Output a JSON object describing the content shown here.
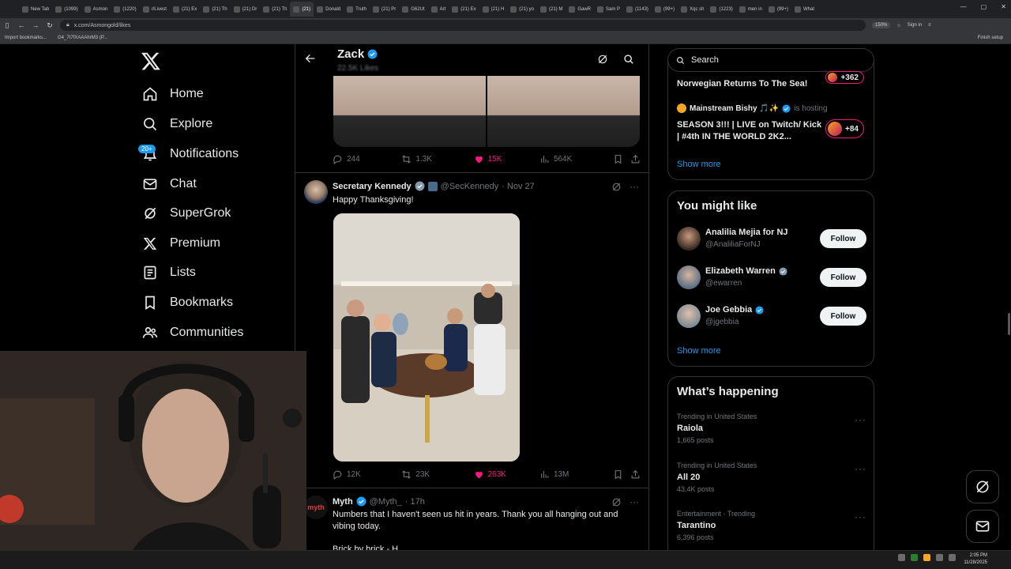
{
  "browser": {
    "tabs": [
      "New Tab",
      "(1099)",
      "Asmon",
      "(1220)",
      "r/Livest",
      "(21) Ex",
      "(21) Th",
      "(21) Dr",
      "(21) Th",
      "(21)",
      "Donald",
      "Truth",
      "(21) Pr",
      "G62Ut",
      "Art",
      "(21) Ex",
      "(21) H",
      "(21) yo",
      "(21) M",
      "GawR",
      "Sam P",
      "(1143)",
      "(99+)",
      "Xqc sh",
      "(1223)",
      "men in",
      "(99+)",
      "What"
    ],
    "active_tab_index": 9,
    "url": "x.com/Asmongold/likes",
    "zoom": "150%",
    "sign_in": "Sign in",
    "bookmarks": [
      "Import bookmarks...",
      "G4_7t7fXAAAhrM3 (P..."
    ],
    "finish_setup": "Finish setup",
    "window_controls": [
      "—",
      "▢",
      "✕"
    ]
  },
  "nav": {
    "items": [
      {
        "label": "Home",
        "icon": "home-icon"
      },
      {
        "label": "Explore",
        "icon": "search-icon"
      },
      {
        "label": "Notifications",
        "icon": "bell-icon",
        "badge": "20+"
      },
      {
        "label": "Chat",
        "icon": "mail-icon"
      },
      {
        "label": "SuperGrok",
        "icon": "grok-icon"
      },
      {
        "label": "Premium",
        "icon": "x-logo-icon"
      },
      {
        "label": "Lists",
        "icon": "list-icon"
      },
      {
        "label": "Bookmarks",
        "icon": "bookmark-icon"
      },
      {
        "label": "Communities",
        "icon": "communities-icon"
      }
    ]
  },
  "header": {
    "name": "Zack",
    "likes": "22.5K Likes"
  },
  "tweet1_actions": {
    "replies": "244",
    "reposts": "1.3K",
    "likes": "15K",
    "views": "564K"
  },
  "tweet2": {
    "name": "Secretary Kennedy",
    "handle": "@SecKennedy",
    "date": "· Nov 27",
    "text": "Happy Thanksgiving!",
    "actions": {
      "replies": "12K",
      "reposts": "23K",
      "likes": "263K",
      "views": "13M"
    }
  },
  "tweet3": {
    "name": "Myth",
    "handle": "@Myth_",
    "date": "· 17h",
    "avatar_text": "myth",
    "text": "Numbers that I haven't seen us hit in years. Thank you all hanging out and vibing today.",
    "text2": "Brick by brick - H"
  },
  "search": {
    "placeholder": "Search"
  },
  "live": {
    "item1_title": "Norwegian Returns To The Sea!",
    "item1_count": "+362",
    "host_name": "Mainstream Bishy 🎵✨",
    "host_suffix": "is hosting",
    "item2_title": "SEASON 3!!! | LIVE on Twitch/ Kick | #4th IN THE WORLD 2K2...",
    "item2_count": "+84",
    "show_more": "Show more"
  },
  "who_to_follow": {
    "title": "You might like",
    "users": [
      {
        "name": "Analilia Mejia for NJ",
        "handle": "@AnaliliaForNJ",
        "verified": false
      },
      {
        "name": "Elizabeth Warren",
        "handle": "@ewarren",
        "verified": "grey"
      },
      {
        "name": "Joe Gebbia",
        "handle": "@jgebbia",
        "verified": "blue"
      }
    ],
    "follow_label": "Follow",
    "show_more": "Show more"
  },
  "trending": {
    "title": "What’s happening",
    "items": [
      {
        "context": "Trending in United States",
        "name": "Raiola",
        "count": "1,665 posts"
      },
      {
        "context": "Trending in United States",
        "name": "All 20",
        "count": "43.4K posts"
      },
      {
        "context": "Entertainment · Trending",
        "name": "Tarantino",
        "count": "6,396 posts"
      }
    ]
  },
  "taskbar": {
    "time": "2:05 PM",
    "date": "11/28/2025"
  },
  "colors": {
    "accent": "#1d9bf0",
    "like": "#f91880",
    "border": "#2f3336",
    "muted": "#71767b"
  }
}
